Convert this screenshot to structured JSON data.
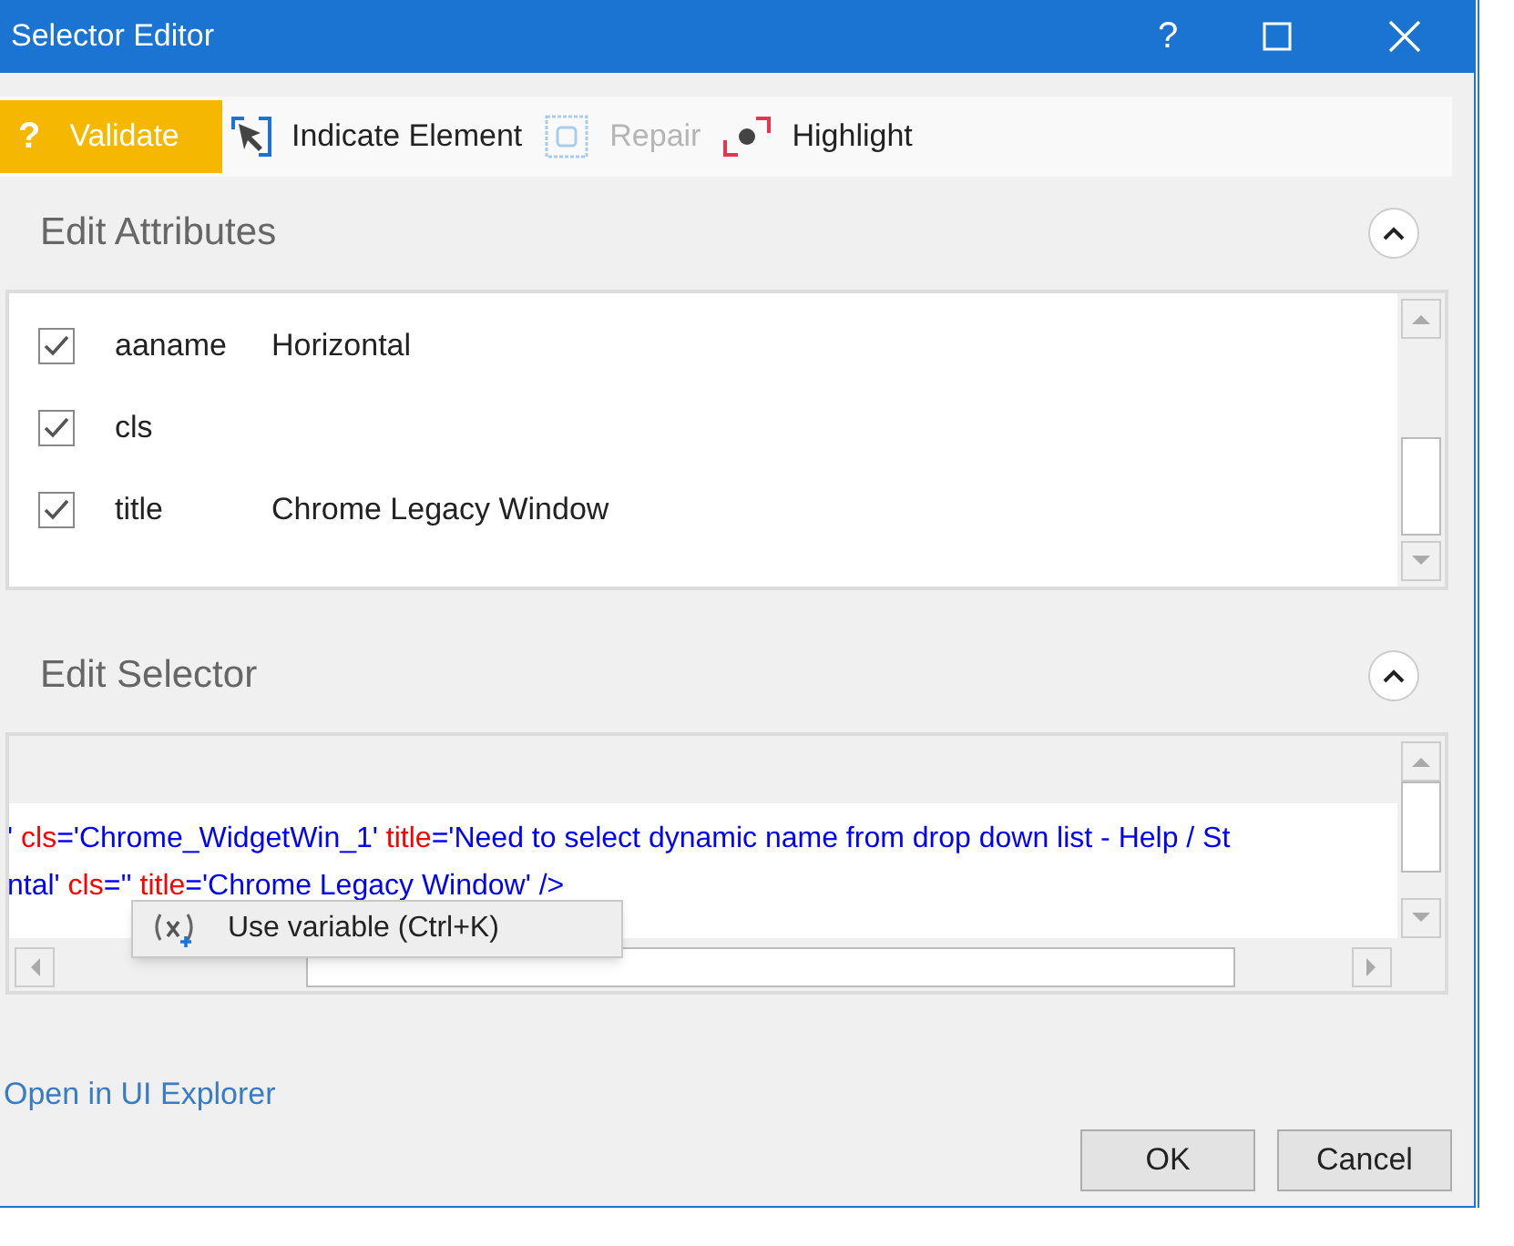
{
  "window": {
    "title": "Selector Editor",
    "controls": [
      "?"
    ]
  },
  "toolbar": [
    {
      "kind": "validate",
      "label": "Validate",
      "icon": "?",
      "disabled": false
    },
    {
      "kind": "indicate",
      "label": "Indicate Element",
      "disabled": false
    },
    {
      "kind": "repair",
      "label": "Repair",
      "disabled": true
    },
    {
      "kind": "highlight",
      "label": "Highlight",
      "disabled": false
    }
  ],
  "attributes": {
    "title": "Edit Attributes",
    "expanded": true,
    "rows": [
      {
        "name": "aaname",
        "value": "Horizontal",
        "checked": true
      },
      {
        "name": "cls",
        "checked": true
      },
      {
        "name": "title",
        "value": "Chrome Legacy Window",
        "checked": true
      }
    ]
  },
  "selector": {
    "title": "Edit Selector",
    "expanded": true,
    "lines": [
      [
        {
          "kind": "value",
          "text": "'"
        },
        {
          "kind": "attr",
          "text": " cls"
        },
        {
          "kind": "value",
          "text": "='Chrome_WidgetWin_1'"
        },
        {
          "kind": "attr",
          "text": " title"
        },
        {
          "kind": "value",
          "text": "='Need to select dynamic name from drop down list - Help / St"
        }
      ],
      [
        {
          "kind": "value",
          "text": "ntal'"
        },
        {
          "kind": "attr",
          "text": " cls"
        },
        {
          "kind": "value",
          "text": "=''"
        },
        {
          "kind": "attr",
          "text": " title"
        },
        {
          "kind": "value",
          "text": "='Chrome Legacy Window' />"
        }
      ]
    ]
  },
  "context_menu": {
    "items": [
      {
        "label": "Use variable (Ctrl+K)"
      }
    ]
  },
  "link": "Open in UI Explorer",
  "buttons": [
    "OK",
    "Cancel"
  ]
}
